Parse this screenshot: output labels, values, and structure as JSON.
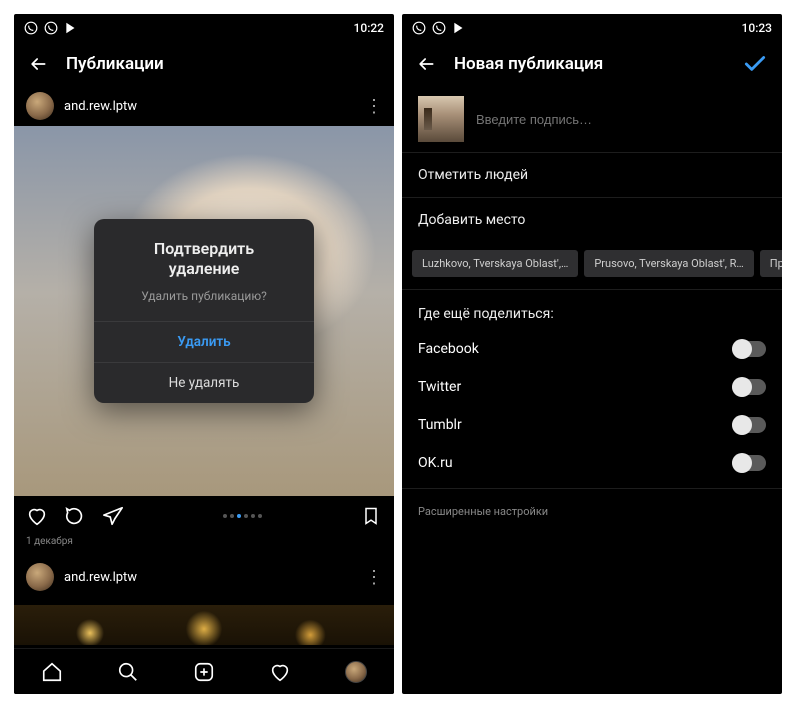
{
  "left": {
    "status_time": "10:22",
    "header_title": "Публикации",
    "post1": {
      "username": "and.rew.lptw",
      "date": "1 декабря"
    },
    "dialog": {
      "title_line1": "Подтвердить",
      "title_line2": "удаление",
      "message": "Удалить публикацию?",
      "confirm": "Удалить",
      "cancel": "Не удалять"
    },
    "post2": {
      "username": "and.rew.lptw"
    }
  },
  "right": {
    "status_time": "10:23",
    "header_title": "Новая публикация",
    "caption_placeholder": "Введите подпись…",
    "tag_people": "Отметить людей",
    "add_location": "Добавить место",
    "locations": [
      "Luzhkovo, Tverskaya Oblast',…",
      "Prusovo, Tverskaya Oblast', R…",
      "Прямух…"
    ],
    "share_also_label": "Где ещё поделиться:",
    "share_targets": [
      "Facebook",
      "Twitter",
      "Tumblr",
      "OK.ru"
    ],
    "advanced": "Расширенные настройки"
  }
}
